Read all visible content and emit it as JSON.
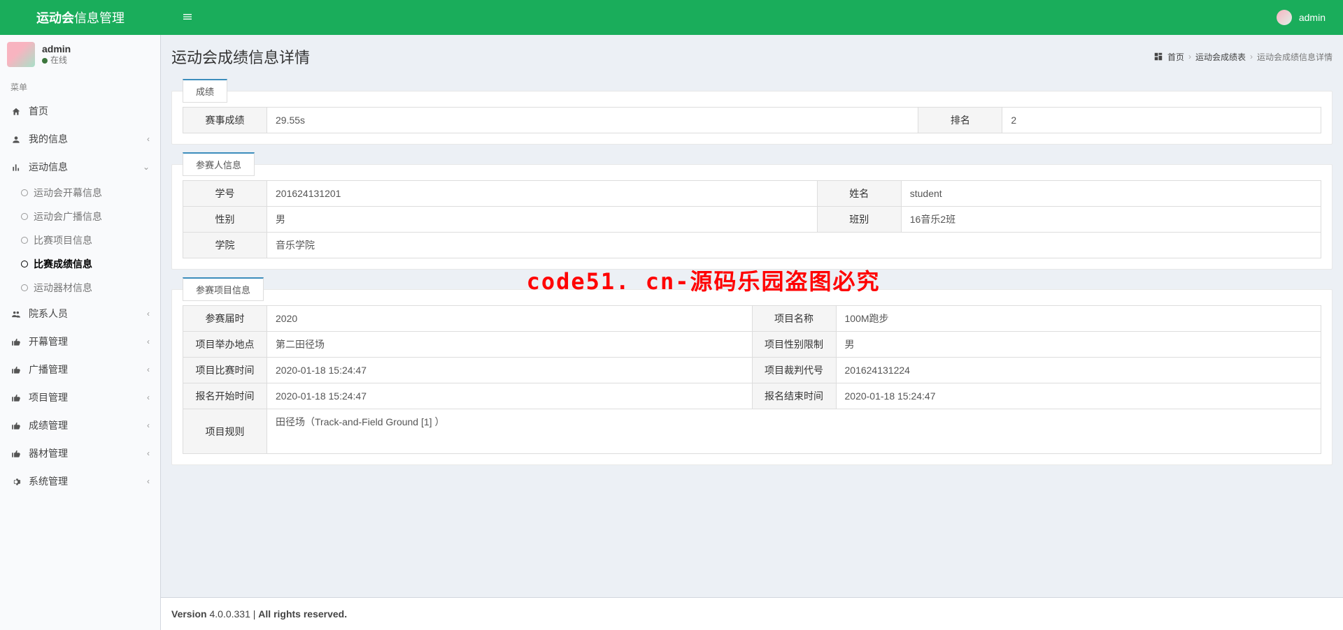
{
  "brand": {
    "bold": "运动会",
    "light": "信息管理"
  },
  "topbar": {
    "username": "admin"
  },
  "user_panel": {
    "name": "admin",
    "status": "在线"
  },
  "sidebar_header": "菜单",
  "nav": {
    "home": "首页",
    "my_info": "我的信息",
    "sport_info": "运动信息",
    "sport_children": [
      {
        "label": "运动会开幕信息",
        "active": false
      },
      {
        "label": "运动会广播信息",
        "active": false
      },
      {
        "label": "比赛项目信息",
        "active": false
      },
      {
        "label": "比赛成绩信息",
        "active": true
      },
      {
        "label": "运动器材信息",
        "active": false
      }
    ],
    "dept_people": "院系人员",
    "opening_mgmt": "开幕管理",
    "broadcast_mgmt": "广播管理",
    "project_mgmt": "项目管理",
    "score_mgmt": "成绩管理",
    "equipment_mgmt": "器材管理",
    "system_mgmt": "系统管理"
  },
  "page": {
    "title": "运动会成绩信息详情",
    "breadcrumb": {
      "home": "首页",
      "list": "运动会成绩表",
      "current": "运动会成绩信息详情"
    }
  },
  "sections": {
    "score": {
      "tab": "成绩",
      "fields": {
        "result_label": "赛事成绩",
        "result_value": "29.55s",
        "rank_label": "排名",
        "rank_value": "2"
      }
    },
    "participant": {
      "tab": "参赛人信息",
      "fields": {
        "sid_label": "学号",
        "sid_value": "201624131201",
        "name_label": "姓名",
        "name_value": "student",
        "gender_label": "性别",
        "gender_value": "男",
        "class_label": "班别",
        "class_value": "16音乐2班",
        "college_label": "学院",
        "college_value": "音乐学院"
      }
    },
    "event": {
      "tab": "参赛项目信息",
      "fields": {
        "session_label": "参赛届时",
        "session_value": "2020",
        "event_name_label": "项目名称",
        "event_name_value": "100M跑步",
        "venue_label": "项目举办地点",
        "venue_value": "第二田径场",
        "gender_limit_label": "项目性别限制",
        "gender_limit_value": "男",
        "match_time_label": "项目比赛时间",
        "match_time_value": "2020-01-18 15:24:47",
        "referee_label": "项目裁判代号",
        "referee_value": "201624131224",
        "reg_start_label": "报名开始时间",
        "reg_start_value": "2020-01-18 15:24:47",
        "reg_end_label": "报名结束时间",
        "reg_end_value": "2020-01-18 15:24:47",
        "rules_label": "项目规则",
        "rules_value": "田径场（Track-and-Field Ground [1]  ）"
      }
    }
  },
  "watermark": "code51. cn-源码乐园盗图必究",
  "footer": {
    "version_label": "Version",
    "version": "4.0.0.331",
    "rights": "All rights reserved."
  }
}
